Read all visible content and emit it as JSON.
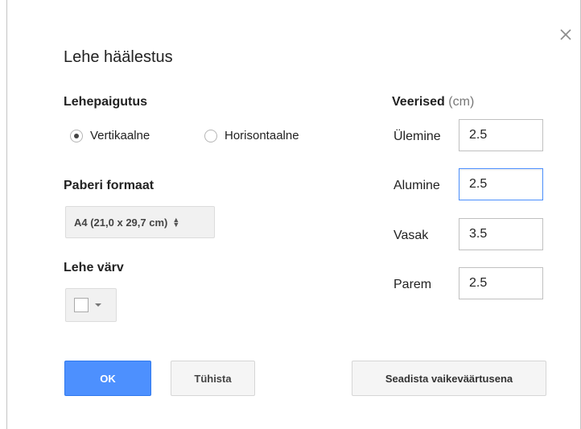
{
  "dialog": {
    "title": "Lehe häälestus",
    "close_icon": "close-icon"
  },
  "orientation": {
    "label": "Lehepaigutus",
    "options": [
      {
        "label": "Vertikaalne",
        "selected": true
      },
      {
        "label": "Horisontaalne",
        "selected": false
      }
    ]
  },
  "paper": {
    "label": "Paberi formaat",
    "selected": "A4 (21,0 x 29,7 cm)"
  },
  "page_color": {
    "label": "Lehe värv",
    "value": "#ffffff"
  },
  "margins": {
    "label": "Veerised",
    "unit": "(cm)",
    "fields": [
      {
        "label": "Ülemine",
        "value": "2.5"
      },
      {
        "label": "Alumine",
        "value": "2.5"
      },
      {
        "label": "Vasak",
        "value": "3.5"
      },
      {
        "label": "Parem",
        "value": "2.5"
      }
    ]
  },
  "buttons": {
    "ok": "OK",
    "cancel": "Tühista",
    "set_default": "Seadista vaikeväärtusena"
  },
  "colors": {
    "primary": "#4d90fe",
    "focus_border": "#4d90fe"
  }
}
